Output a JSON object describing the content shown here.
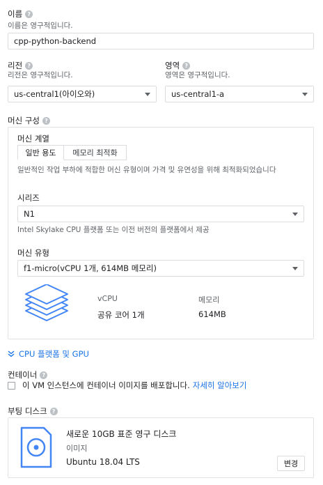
{
  "name": {
    "label": "이름",
    "hint": "이름은 영구적입니다.",
    "value": "cpp-python-backend"
  },
  "region": {
    "label": "리전",
    "hint": "리전은 영구적입니다.",
    "value": "us-central1(아이오와)"
  },
  "zone": {
    "label": "영역",
    "hint": "영역은 영구적입니다.",
    "value": "us-central1-a"
  },
  "machine_config": {
    "label": "머신 구성",
    "family_label": "머신 계열",
    "tabs": [
      "일반 용도",
      "메모리 최적화"
    ],
    "family_desc": "일반적인 작업 부하에 적합한 머신 유형이며 가격 및 유연성을 위해 최적화되었습니다",
    "series_label": "시리즈",
    "series_value": "N1",
    "series_desc": "Intel Skylake CPU 플랫폼 또는 이전 버전의 플랫폼에서 제공",
    "type_label": "머신 유형",
    "type_value": "f1-micro(vCPU 1개, 614MB 메모리)",
    "vcpu_header": "vCPU",
    "memory_header": "메모리",
    "vcpu_value": "공유 코어 1개",
    "memory_value": "614MB",
    "icon": "stacked-layers-icon"
  },
  "cpu_gpu_link": "CPU 플랫폼 및 GPU",
  "container": {
    "label": "컨테이너",
    "checkbox_text": "이 VM 인스턴스에 컨테이너 이미지를 배포합니다.",
    "learn_more": "자세히 알아보기"
  },
  "boot_disk": {
    "label": "부팅 디스크",
    "title": "새로운 10GB 표준 영구 디스크",
    "image_label": "이미지",
    "image_value": "Ubuntu 18.04 LTS",
    "change_button": "변경",
    "icon": "disk-icon"
  },
  "colors": {
    "accent": "#1a73e8",
    "icon_blue": "#4285f4"
  }
}
